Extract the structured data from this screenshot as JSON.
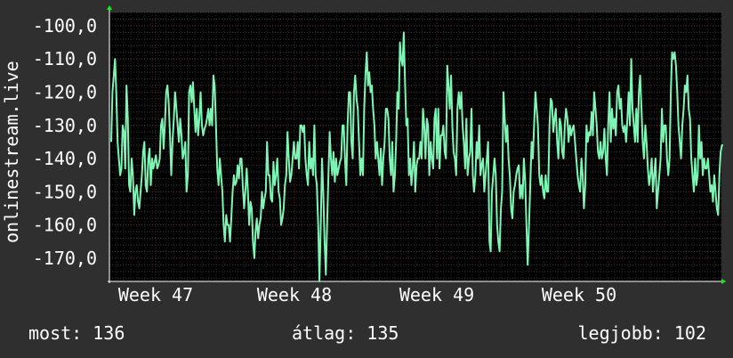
{
  "chart_data": {
    "type": "line",
    "ylabel": "onlinestream.live",
    "ylim": [
      -177,
      -96
    ],
    "y_ticks": [
      "-100,0",
      "-110,0",
      "-120,0",
      "-130,0",
      "-140,0",
      "-150,0",
      "-160,0",
      "-170,0"
    ],
    "y_tick_values": [
      -100,
      -110,
      -120,
      -130,
      -140,
      -150,
      -160,
      -170
    ],
    "x_ticks": [
      "Week 47",
      "Week 48",
      "Week 49",
      "Week 50"
    ],
    "x_tick_positions": [
      6.5,
      26,
      46,
      66
    ],
    "xlim": [
      0,
      86
    ],
    "grid": true,
    "colors": {
      "line": "#7ef5b4",
      "background": "#000000",
      "grid": "#3a3a3a",
      "axis_arrow": "#00ff00"
    },
    "series": [
      {
        "values": [
          -135,
          -120,
          -115,
          -110,
          -120,
          -135,
          -140,
          -145,
          -143,
          -130,
          -132,
          -143,
          -118,
          -128,
          -148,
          -150,
          -140,
          -145,
          -157,
          -150,
          -148,
          -153,
          -155,
          -150,
          -145,
          -138,
          -135,
          -148,
          -150,
          -140,
          -137,
          -148,
          -140,
          -143,
          -141,
          -139,
          -143,
          -142,
          -140,
          -130,
          -128,
          -137,
          -130,
          -120,
          -118,
          -123,
          -133,
          -145,
          -135,
          -128,
          -120,
          -125,
          -130,
          -135,
          -128,
          -133,
          -140,
          -138,
          -135,
          -150,
          -145,
          -120,
          -118,
          -123,
          -117,
          -125,
          -132,
          -125,
          -133,
          -128,
          -120,
          -130,
          -133,
          -131,
          -130,
          -128,
          -125,
          -130,
          -125,
          -130,
          -115,
          -118,
          -130,
          -143,
          -148,
          -140,
          -145,
          -150,
          -160,
          -165,
          -157,
          -160,
          -160,
          -165,
          -158,
          -150,
          -145,
          -148,
          -147,
          -142,
          -146,
          -140,
          -140,
          -148,
          -155,
          -150,
          -143,
          -150,
          -160,
          -153,
          -155,
          -165,
          -170,
          -162,
          -158,
          -164,
          -160,
          -158,
          -150,
          -155,
          -152,
          -150,
          -135,
          -145,
          -145,
          -152,
          -153,
          -141,
          -148,
          -145,
          -140,
          -150,
          -152,
          -160,
          -158,
          -155,
          -148,
          -145,
          -132,
          -140,
          -147,
          -145,
          -140,
          -135,
          -140,
          -140,
          -135,
          -143,
          -130,
          -130,
          -132,
          -130,
          -140,
          -145,
          -148,
          -135,
          -143,
          -140,
          -145,
          -130,
          -145,
          -148,
          -160,
          -177,
          -160,
          -140,
          -150,
          -165,
          -175,
          -160,
          -145,
          -132,
          -140,
          -145,
          -138,
          -147,
          -140,
          -145,
          -143,
          -141,
          -140,
          -130,
          -130,
          -140,
          -148,
          -130,
          -120,
          -120,
          -135,
          -140,
          -120,
          -115,
          -122,
          -125,
          -135,
          -145,
          -140,
          -145,
          -125,
          -115,
          -108,
          -118,
          -114,
          -120,
          -118,
          -125,
          -130,
          -140,
          -135,
          -140,
          -145,
          -137,
          -148,
          -140,
          -135,
          -125,
          -125,
          -128,
          -140,
          -145,
          -135,
          -150,
          -145,
          -135,
          -120,
          -125,
          -105,
          -110,
          -112,
          -102,
          -118,
          -130,
          -128,
          -145,
          -140,
          -148,
          -143,
          -135,
          -150,
          -142,
          -140,
          -140,
          -135,
          -140,
          -125,
          -130,
          -140,
          -128,
          -130,
          -145,
          -135,
          -140,
          -143,
          -128,
          -125,
          -140,
          -125,
          -143,
          -133,
          -133,
          -130,
          -138,
          -140,
          -112,
          -118,
          -125,
          -115,
          -130,
          -138,
          -140,
          -145,
          -125,
          -120,
          -125,
          -120,
          -130,
          -135,
          -143,
          -128,
          -145,
          -140,
          -138,
          -125,
          -145,
          -150,
          -145,
          -135,
          -140,
          -130,
          -145,
          -142,
          -140,
          -150,
          -145,
          -140,
          -135,
          -165,
          -168,
          -150,
          -145,
          -140,
          -145,
          -160,
          -165,
          -168,
          -155,
          -150,
          -120,
          -128,
          -135,
          -130,
          -140,
          -145,
          -155,
          -158,
          -150,
          -148,
          -145,
          -143,
          -142,
          -152,
          -148,
          -152,
          -140,
          -147,
          -160,
          -172,
          -160,
          -148,
          -135,
          -140,
          -130,
          -120,
          -125,
          -130,
          -145,
          -148,
          -145,
          -150,
          -152,
          -145,
          -150,
          -150,
          -130,
          -122,
          -123,
          -132,
          -128,
          -125,
          -135,
          -140,
          -128,
          -130,
          -138,
          -140,
          -130,
          -125,
          -128,
          -135,
          -130,
          -133,
          -131,
          -130,
          -135,
          -140,
          -145,
          -148,
          -150,
          -140,
          -145,
          -155,
          -148,
          -130,
          -135,
          -132,
          -133,
          -126,
          -133,
          -120,
          -125,
          -130,
          -138,
          -140,
          -135,
          -140,
          -138,
          -131,
          -140,
          -145,
          -130,
          -120,
          -135,
          -125,
          -131,
          -128,
          -133,
          -120,
          -118,
          -125,
          -122,
          -130,
          -132,
          -130,
          -135,
          -128,
          -120,
          -130,
          -110,
          -125,
          -130,
          -135,
          -125,
          -135,
          -120,
          -115,
          -125,
          -135,
          -140,
          -130,
          -135,
          -143,
          -148,
          -145,
          -140,
          -150,
          -145,
          -140,
          -155,
          -150,
          -145,
          -140,
          -125,
          -135,
          -130,
          -130,
          -140,
          -145,
          -140,
          -120,
          -108,
          -110,
          -108,
          -112,
          -120,
          -130,
          -135,
          -140,
          -130,
          -125,
          -118,
          -120,
          -115,
          -125,
          -128,
          -140,
          -145,
          -150,
          -140,
          -148,
          -145,
          -130,
          -140,
          -135,
          -145,
          -140,
          -143,
          -143,
          -140,
          -145,
          -150,
          -148,
          -153,
          -145,
          -150,
          -155,
          -157,
          -145,
          -138,
          -136,
          -136
        ],
        "color": "#7ef5b4"
      }
    ]
  },
  "footer": {
    "now_label": "most:",
    "now_value": "136",
    "avg_label": "átlag:",
    "avg_value": "135",
    "best_label": "legjobb:",
    "best_value": "102"
  }
}
